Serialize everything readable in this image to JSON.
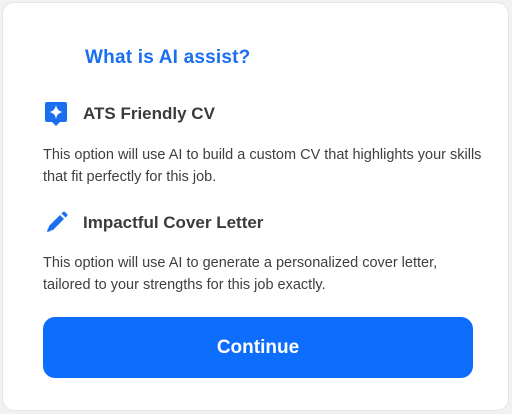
{
  "dialog": {
    "title": "What is AI assist?",
    "accent_color": "#1a6ff0",
    "options": [
      {
        "icon": "sparkle-badge-icon",
        "label": "ATS Friendly CV",
        "description": "This option will use AI to build a custom CV that highlights your skills that fit perfectly for this job."
      },
      {
        "icon": "pencil-icon",
        "label": "Impactful Cover Letter",
        "description": "This option will use AI to generate a personalized cover letter, tailored to your strengths for this job exactly."
      }
    ],
    "continue_label": "Continue",
    "button_color": "#0d6efd"
  }
}
